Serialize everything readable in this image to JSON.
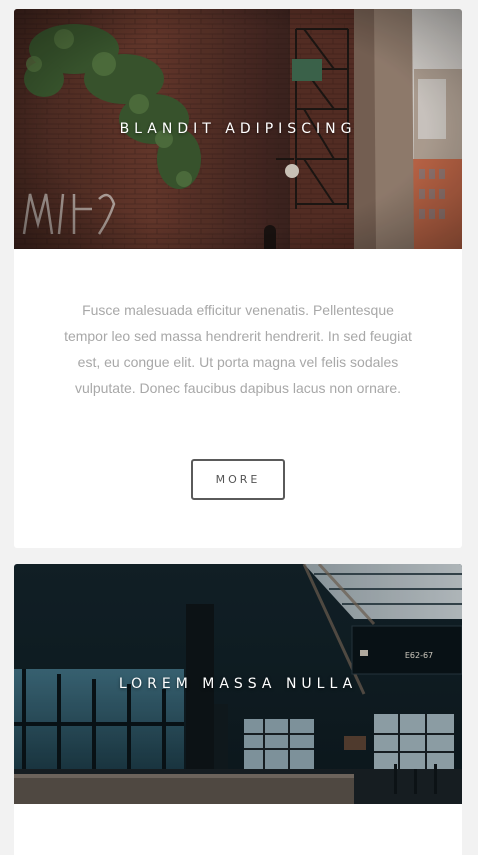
{
  "cards": [
    {
      "title": "BLANDIT ADIPISCING",
      "body": "Fusce malesuada efficitur venenatis. Pellentesque tempor leo sed massa hendrerit hendrerit. In sed feugiat est, eu congue elit. Ut porta magna vel felis sodales vulputate. Donec faucibus dapibus lacus non ornare.",
      "button_label": "MORE"
    },
    {
      "title": "LOREM MASSA NULLA",
      "sign_text": "E62-67"
    }
  ]
}
